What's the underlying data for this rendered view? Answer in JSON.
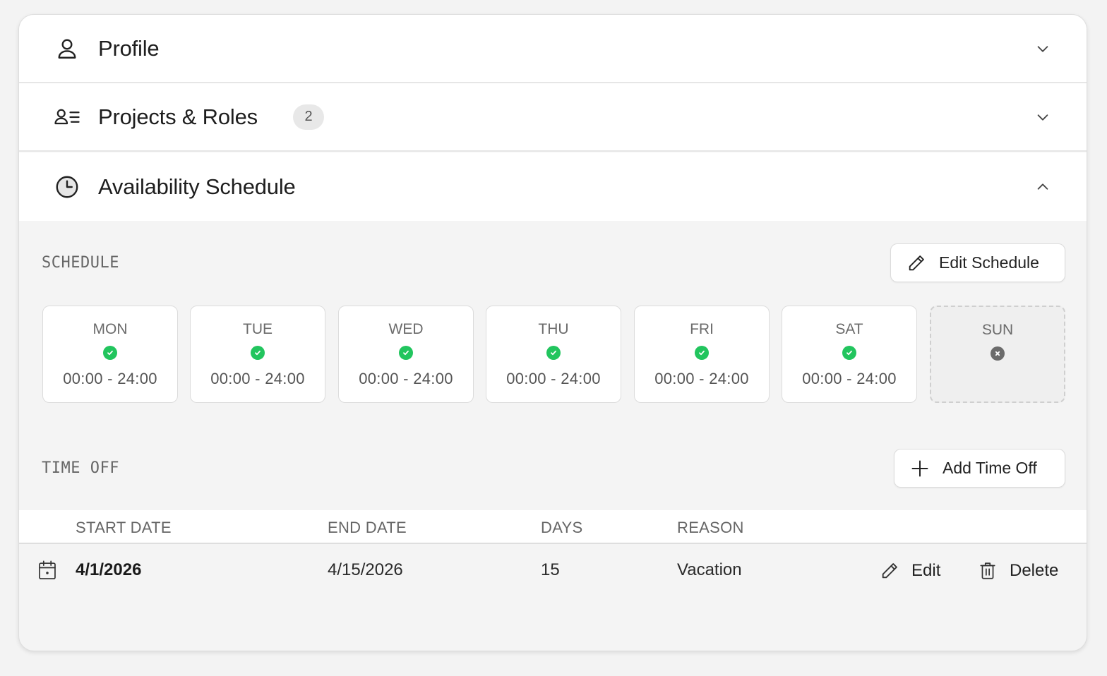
{
  "sections": {
    "profile": {
      "title": "Profile",
      "icon": "user-icon",
      "expanded": false
    },
    "projects": {
      "title": "Projects & Roles",
      "icon": "user-list-icon",
      "badge": "2",
      "expanded": false
    },
    "availability": {
      "title": "Availability Schedule",
      "icon": "clock-icon",
      "expanded": true
    }
  },
  "schedule": {
    "label": "SCHEDULE",
    "edit_button": "Edit Schedule",
    "days": [
      {
        "name": "MON",
        "available": true,
        "time": "00:00 - 24:00"
      },
      {
        "name": "TUE",
        "available": true,
        "time": "00:00 - 24:00"
      },
      {
        "name": "WED",
        "available": true,
        "time": "00:00 - 24:00"
      },
      {
        "name": "THU",
        "available": true,
        "time": "00:00 - 24:00"
      },
      {
        "name": "FRI",
        "available": true,
        "time": "00:00 - 24:00"
      },
      {
        "name": "SAT",
        "available": true,
        "time": "00:00 - 24:00"
      },
      {
        "name": "SUN",
        "available": false,
        "time": ""
      }
    ]
  },
  "time_off": {
    "label": "TIME OFF",
    "add_button": "Add Time Off",
    "columns": [
      "START DATE",
      "END DATE",
      "DAYS",
      "REASON"
    ],
    "rows": [
      {
        "start": "4/1/2026",
        "end": "4/15/2026",
        "days": "15",
        "reason": "Vacation",
        "edit": "Edit",
        "delete": "Delete"
      }
    ]
  },
  "colors": {
    "available": "#22c55e",
    "unavailable": "#6b6b6b",
    "card_bg": "#f4f4f4",
    "header_bg": "#ffffff"
  }
}
